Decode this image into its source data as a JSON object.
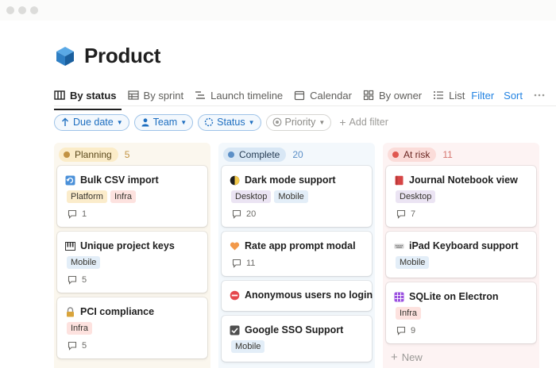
{
  "window": {
    "controls": [
      "close",
      "minimize",
      "maximize"
    ]
  },
  "page": {
    "title": "Product",
    "icon": "cube-icon"
  },
  "tabs": [
    {
      "label": "By status",
      "icon": "board-icon",
      "active": true
    },
    {
      "label": "By sprint",
      "icon": "table-icon"
    },
    {
      "label": "Launch timeline",
      "icon": "timeline-icon"
    },
    {
      "label": "Calendar",
      "icon": "calendar-icon"
    },
    {
      "label": "By owner",
      "icon": "gallery-icon"
    },
    {
      "label": "List",
      "icon": "list-icon"
    }
  ],
  "toolbar": {
    "filter": "Filter",
    "sort": "Sort",
    "more": "more-icon"
  },
  "filters": {
    "due_date": "Due date",
    "team": "Team",
    "status": "Status",
    "priority": "Priority",
    "add_filter": "Add filter"
  },
  "colors": {
    "accent": "#2383e2",
    "planning_bg": "#fbf7ee",
    "complete_bg": "#f3f8fc",
    "at_risk_bg": "#fdf3f3"
  },
  "columns": [
    {
      "label": "Planning",
      "count": "5",
      "cards": [
        {
          "title": "Bulk CSV import",
          "icon": "refresh-icon",
          "tags": [
            "Platform",
            "Infra"
          ],
          "comments": "1"
        },
        {
          "title": "Unique project keys",
          "icon": "piano-icon",
          "tags": [
            "Mobile"
          ],
          "comments": "5"
        },
        {
          "title": "PCI compliance",
          "icon": "lock-icon",
          "tags": [
            "Infra"
          ],
          "comments": "5"
        }
      ]
    },
    {
      "label": "Complete",
      "count": "20",
      "cards": [
        {
          "title": "Dark mode support",
          "icon": "half-moon-icon",
          "tags": [
            "Desktop",
            "Mobile"
          ],
          "comments": "20"
        },
        {
          "title": "Rate app prompt modal",
          "icon": "heart-icon",
          "tags": [],
          "comments": "11"
        },
        {
          "title": "Anonymous users no login",
          "icon": "no-entry-icon",
          "tags": [],
          "comments": ""
        },
        {
          "title": "Google SSO Support",
          "icon": "checkbox-icon",
          "tags": [
            "Mobile"
          ],
          "comments": ""
        }
      ]
    },
    {
      "label": "At risk",
      "count": "11",
      "cards": [
        {
          "title": "Journal Notebook view",
          "icon": "book-icon",
          "tags": [
            "Desktop"
          ],
          "comments": "7"
        },
        {
          "title": "iPad Keyboard support",
          "icon": "keyboard-icon",
          "tags": [
            "Mobile"
          ],
          "comments": ""
        },
        {
          "title": "SQLite on Electron",
          "icon": "grid-icon",
          "tags": [
            "Infra"
          ],
          "comments": "9"
        }
      ],
      "new_label": "New"
    }
  ]
}
